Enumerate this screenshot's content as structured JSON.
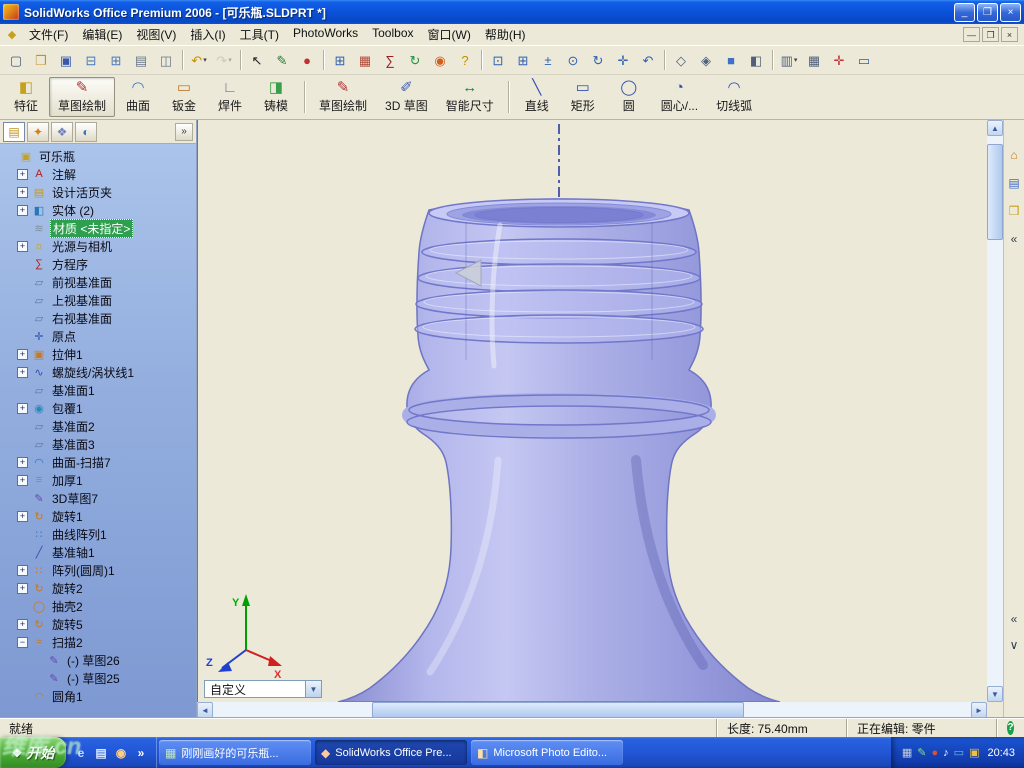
{
  "titlebar": {
    "title": "SolidWorks Office Premium 2006 - [可乐瓶.SLDPRT *]",
    "controls": [
      {
        "name": "minimize-button",
        "glyph": "_"
      },
      {
        "name": "restore-button",
        "glyph": "❐"
      },
      {
        "name": "close-button",
        "glyph": "×",
        "close": true
      }
    ]
  },
  "menubar": {
    "doc_icon_glyph": "◆",
    "items": [
      {
        "name": "file",
        "label": "文件(F)"
      },
      {
        "name": "edit",
        "label": "编辑(E)"
      },
      {
        "name": "view",
        "label": "视图(V)"
      },
      {
        "name": "insert",
        "label": "插入(I)"
      },
      {
        "name": "tools",
        "label": "工具(T)"
      },
      {
        "name": "photoworks",
        "label": "PhotoWorks"
      },
      {
        "name": "toolbox",
        "label": "Toolbox"
      },
      {
        "name": "window",
        "label": "窗口(W)"
      },
      {
        "name": "help",
        "label": "帮助(H)"
      }
    ],
    "mdi_controls": [
      {
        "name": "doc-minimize-button",
        "glyph": "—"
      },
      {
        "name": "doc-restore-button",
        "glyph": "❐"
      },
      {
        "name": "doc-close-button",
        "glyph": "×"
      }
    ]
  },
  "toolbar_std": {
    "buttons": [
      {
        "name": "new-document",
        "glyph": "▢",
        "color": "#4A5A78"
      },
      {
        "name": "open-document",
        "glyph": "❒",
        "color": "#C89020"
      },
      {
        "name": "save-document",
        "glyph": "▣",
        "color": "#3858A8"
      },
      {
        "name": "make-drawing-from-part",
        "glyph": "⊟",
        "color": "#4878B8"
      },
      {
        "name": "make-assembly-from-part",
        "glyph": "⊞",
        "color": "#4878B8"
      },
      {
        "name": "print-document",
        "glyph": "▤",
        "color": "#68788C"
      },
      {
        "name": "print-preview",
        "glyph": "◫",
        "color": "#68788C"
      },
      {
        "sep": true
      },
      {
        "name": "undo",
        "glyph": "↶",
        "color": "#C89000",
        "dropdown": true
      },
      {
        "name": "redo",
        "glyph": "↷",
        "color": "#9A9A9A",
        "dropdown": true,
        "disabled": true
      },
      {
        "sep": true
      },
      {
        "name": "select-tool",
        "glyph": "↖",
        "color": "#202020"
      },
      {
        "name": "sketch-pencil-tool",
        "glyph": "✎",
        "color": "#208030"
      },
      {
        "name": "photoworks-preview",
        "glyph": "●",
        "color": "#C03030"
      },
      {
        "sep": true
      },
      {
        "name": "design-table",
        "glyph": "⊞",
        "color": "#3060B0"
      },
      {
        "name": "photoworks-scene",
        "glyph": "▦",
        "color": "#B04838"
      },
      {
        "name": "equations-tool",
        "glyph": "∑",
        "color": "#902020"
      },
      {
        "name": "rebuild",
        "glyph": "↻",
        "color": "#209040"
      },
      {
        "name": "render-tool",
        "glyph": "◉",
        "color": "#D06020"
      },
      {
        "name": "help-tool",
        "glyph": "?",
        "color": "#C09000"
      },
      {
        "sep": true
      },
      {
        "name": "zoom-to-fit",
        "glyph": "⊡",
        "color": "#3060B0"
      },
      {
        "name": "zoom-to-area",
        "glyph": "⊞",
        "color": "#3060B0"
      },
      {
        "name": "zoom-in-out",
        "glyph": "±",
        "color": "#3060B0"
      },
      {
        "name": "zoom-to-selection",
        "glyph": "⊙",
        "color": "#3060B0"
      },
      {
        "name": "rotate-view",
        "glyph": "↻",
        "color": "#3060B0"
      },
      {
        "name": "pan-view",
        "glyph": "✛",
        "color": "#3060B0"
      },
      {
        "name": "previous-view",
        "glyph": "↶",
        "color": "#3060B0"
      },
      {
        "sep": true
      },
      {
        "name": "wireframe-display",
        "glyph": "◇",
        "color": "#50607C"
      },
      {
        "name": "hidden-lines-display",
        "glyph": "◈",
        "color": "#50607C"
      },
      {
        "name": "shaded-display",
        "glyph": "■",
        "color": "#4070C8"
      },
      {
        "name": "section-view",
        "glyph": "◧",
        "color": "#50607C"
      },
      {
        "sep": true
      },
      {
        "name": "standard-views",
        "glyph": "▥",
        "color": "#50607C",
        "dropdown": true
      },
      {
        "name": "view-orientation",
        "glyph": "▦",
        "color": "#50607C"
      },
      {
        "name": "reference-triad",
        "glyph": "✛",
        "color": "#C03030"
      },
      {
        "name": "fullscreen-view",
        "glyph": "▭",
        "color": "#3060B0"
      }
    ]
  },
  "commandmanager": {
    "buttons": [
      {
        "name": "tab-features",
        "label": "特征",
        "glyph": "◧",
        "color": "#C8A020"
      },
      {
        "name": "tab-sketch",
        "label": "草图绘制",
        "glyph": "✎",
        "color": "#B03030",
        "active": true
      },
      {
        "name": "tab-surfaces",
        "label": "曲面",
        "glyph": "◠",
        "color": "#3878C8"
      },
      {
        "name": "tab-sheet-metal",
        "label": "钣金",
        "glyph": "▭",
        "color": "#C07828"
      },
      {
        "name": "tab-weldments",
        "label": "焊件",
        "glyph": "∟",
        "color": "#687888"
      },
      {
        "name": "tab-mold",
        "label": "铸模",
        "glyph": "◨",
        "color": "#38A048"
      },
      {
        "sep": true
      },
      {
        "name": "sketch-button",
        "label": "草图绘制",
        "glyph": "✎",
        "color": "#B03030"
      },
      {
        "name": "sketch-3d-button",
        "label": "3D 草图",
        "glyph": "✐",
        "color": "#3858B0"
      },
      {
        "name": "smart-dimension-button",
        "label": "智能尺寸",
        "glyph": "↔",
        "color": "#208040"
      },
      {
        "sep": true
      },
      {
        "name": "line-button",
        "label": "直线",
        "glyph": "╲",
        "color": "#3050B0"
      },
      {
        "name": "rectangle-button",
        "label": "矩形",
        "glyph": "▭",
        "color": "#3050B0"
      },
      {
        "name": "circle-button",
        "label": "圆",
        "glyph": "◯",
        "color": "#3050B0"
      },
      {
        "name": "centerpoint-arc-button",
        "label": "圆心/...",
        "glyph": "◔",
        "color": "#3050B0"
      },
      {
        "name": "tangent-arc-button",
        "label": "切线弧",
        "glyph": "◠",
        "color": "#3050B0"
      }
    ]
  },
  "feature_tree": {
    "collapse_glyph": "»",
    "panel_tabs": [
      {
        "name": "featuremanager-tab",
        "glyph": "▤",
        "color": "#C09020",
        "active": true
      },
      {
        "name": "propertymanager-tab",
        "glyph": "✦",
        "color": "#D08020"
      },
      {
        "name": "configurationmanager-tab",
        "glyph": "❖",
        "color": "#7080C0"
      },
      {
        "name": "thirdparty-tab",
        "glyph": "◐",
        "color": "#3878C0"
      }
    ],
    "items": [
      {
        "name": "part-root",
        "label": "可乐瓶",
        "glyph": "▣",
        "color": "#C8A020",
        "indent": 0,
        "expand": "none"
      },
      {
        "name": "annotations",
        "label": "注解",
        "glyph": "A",
        "color": "#B02020",
        "indent": 1,
        "expand": "plus"
      },
      {
        "name": "design-binder",
        "label": "设计活页夹",
        "glyph": "▤",
        "color": "#C89820",
        "indent": 1,
        "expand": "plus"
      },
      {
        "name": "solid-bodies",
        "label": "实体 (2)",
        "glyph": "◧",
        "color": "#2878B8",
        "indent": 1,
        "expand": "plus"
      },
      {
        "name": "material",
        "label": "材质 <未指定>",
        "glyph": "≋",
        "color": "#8090A0",
        "indent": 1,
        "expand": "none",
        "selected": true
      },
      {
        "name": "lights-cameras",
        "label": "光源与相机",
        "glyph": "☼",
        "color": "#C8A000",
        "indent": 1,
        "expand": "plus"
      },
      {
        "name": "equations",
        "label": "方程序",
        "glyph": "∑",
        "color": "#B02020",
        "indent": 1,
        "expand": "none"
      },
      {
        "name": "front-plane",
        "label": "前视基准面",
        "glyph": "▱",
        "color": "#5878A8",
        "indent": 1,
        "expand": "none"
      },
      {
        "name": "top-plane",
        "label": "上视基准面",
        "glyph": "▱",
        "color": "#5878A8",
        "indent": 1,
        "expand": "none"
      },
      {
        "name": "right-plane",
        "label": "右视基准面",
        "glyph": "▱",
        "color": "#5878A8",
        "indent": 1,
        "expand": "none"
      },
      {
        "name": "origin",
        "label": "原点",
        "glyph": "✛",
        "color": "#3050B0",
        "indent": 1,
        "expand": "none"
      },
      {
        "name": "extrude1",
        "label": "拉伸1",
        "glyph": "▣",
        "color": "#C87820",
        "indent": 1,
        "expand": "plus"
      },
      {
        "name": "helix1",
        "label": "螺旋线/涡状线1",
        "glyph": "∿",
        "color": "#3050B0",
        "indent": 1,
        "expand": "plus"
      },
      {
        "name": "plane1",
        "label": "基准面1",
        "glyph": "▱",
        "color": "#5878A8",
        "indent": 1,
        "expand": "none"
      },
      {
        "name": "wrap1",
        "label": "包覆1",
        "glyph": "◉",
        "color": "#2888B8",
        "indent": 1,
        "expand": "plus"
      },
      {
        "name": "plane2",
        "label": "基准面2",
        "glyph": "▱",
        "color": "#5878A8",
        "indent": 1,
        "expand": "none"
      },
      {
        "name": "plane3",
        "label": "基准面3",
        "glyph": "▱",
        "color": "#5878A8",
        "indent": 1,
        "expand": "none"
      },
      {
        "name": "surface-sweep7",
        "label": "曲面-扫描7",
        "glyph": "◠",
        "color": "#2878B8",
        "indent": 1,
        "expand": "plus"
      },
      {
        "name": "thicken1",
        "label": "加厚1",
        "glyph": "≡",
        "color": "#C87820",
        "indent": 1,
        "expand": "plus"
      },
      {
        "name": "sketch3d7",
        "label": "3D草图7",
        "glyph": "✎",
        "color": "#6048B0",
        "indent": 1,
        "expand": "none"
      },
      {
        "name": "revolve1",
        "label": "旋转1",
        "glyph": "↻",
        "color": "#C87820",
        "indent": 1,
        "expand": "plus"
      },
      {
        "name": "curve-pattern1",
        "label": "曲线阵列1",
        "glyph": "∷",
        "color": "#3878C0",
        "indent": 1,
        "expand": "none"
      },
      {
        "name": "axis1",
        "label": "基准轴1",
        "glyph": "╱",
        "color": "#3050B0",
        "indent": 1,
        "expand": "none"
      },
      {
        "name": "circular-pattern1",
        "label": "阵列(圆周)1",
        "glyph": "∷",
        "color": "#C87820",
        "indent": 1,
        "expand": "plus"
      },
      {
        "name": "revolve2",
        "label": "旋转2",
        "glyph": "↻",
        "color": "#C87820",
        "indent": 1,
        "expand": "plus"
      },
      {
        "name": "shell2",
        "label": "抽壳2",
        "glyph": "◯",
        "color": "#C87820",
        "indent": 1,
        "expand": "none"
      },
      {
        "name": "revolve5",
        "label": "旋转5",
        "glyph": "↻",
        "color": "#C87820",
        "indent": 1,
        "expand": "plus"
      },
      {
        "name": "sweep2",
        "label": "扫描2",
        "glyph": "≈",
        "color": "#C87820",
        "indent": 1,
        "expand": "minus"
      },
      {
        "name": "sketch26",
        "label": "(-) 草图26",
        "glyph": "✎",
        "color": "#6048B0",
        "indent": 2,
        "expand": "none"
      },
      {
        "name": "sketch25",
        "label": "(-) 草图25",
        "glyph": "✎",
        "color": "#6048B0",
        "indent": 2,
        "expand": "none"
      },
      {
        "name": "fillet1",
        "label": "圆角1",
        "glyph": "◠",
        "color": "#C87820",
        "indent": 1,
        "expand": "none"
      }
    ]
  },
  "viewport": {
    "combo_value": "自定义",
    "triad": {
      "x": "X",
      "y": "Y",
      "z": "Z"
    }
  },
  "right_panel": {
    "top_icons": [
      {
        "name": "solidworks-resources",
        "glyph": "⌂",
        "color": "#C87820"
      },
      {
        "name": "design-library",
        "glyph": "▤",
        "color": "#3868C8"
      },
      {
        "name": "file-explorer",
        "glyph": "❒",
        "color": "#C8A020"
      },
      {
        "name": "collapse-pane",
        "glyph": "«",
        "color": "#304050"
      }
    ],
    "bottom_icons": [
      {
        "name": "expand-pane",
        "glyph": "«",
        "color": "#304050"
      },
      {
        "name": "pane-more",
        "glyph": "∨",
        "color": "#304050"
      }
    ]
  },
  "statusbar": {
    "ready": "就绪",
    "length": "长度: 75.40mm",
    "editing": "正在编辑: 零件",
    "help_glyph": "?"
  },
  "taskbar": {
    "start_label": "开始",
    "start_flag_glyph": "❖",
    "quick_launch": [
      {
        "name": "quick-internet-explorer",
        "glyph": "e",
        "color": "#BFDcff"
      },
      {
        "name": "quick-show-desktop",
        "glyph": "▤",
        "color": "#D7E8FF"
      },
      {
        "name": "quick-media-player",
        "glyph": "◉",
        "color": "#FFD080"
      },
      {
        "name": "quick-launch-overflow",
        "glyph": "»",
        "color": "#FFFFFF"
      }
    ],
    "tasks": [
      {
        "name": "task-picture-viewer",
        "label": "刚刚画好的可乐瓶...",
        "glyph": "▦",
        "color": "#BFE8BF",
        "active": false
      },
      {
        "name": "task-solidworks",
        "label": "SolidWorks Office Pre...",
        "glyph": "◆",
        "color": "#FFC8A0",
        "active": true
      },
      {
        "name": "task-photo-editor",
        "label": "Microsoft Photo Edito...",
        "glyph": "◧",
        "color": "#FFE0A0",
        "active": false
      }
    ],
    "tray_icons": [
      {
        "name": "tray-printer",
        "glyph": "▦",
        "color": "#C8CCD8"
      },
      {
        "name": "tray-pen",
        "glyph": "✎",
        "color": "#80E080"
      },
      {
        "name": "tray-antivirus",
        "glyph": "●",
        "color": "#E05030"
      },
      {
        "name": "tray-volume",
        "glyph": "♪",
        "color": "#FFFFFF"
      },
      {
        "name": "tray-display",
        "glyph": "▭",
        "color": "#70B8F0"
      },
      {
        "name": "tray-safety",
        "glyph": "▣",
        "color": "#F0C040"
      }
    ],
    "time": "20:43"
  },
  "watermark": {
    "text": "维库.cn"
  }
}
